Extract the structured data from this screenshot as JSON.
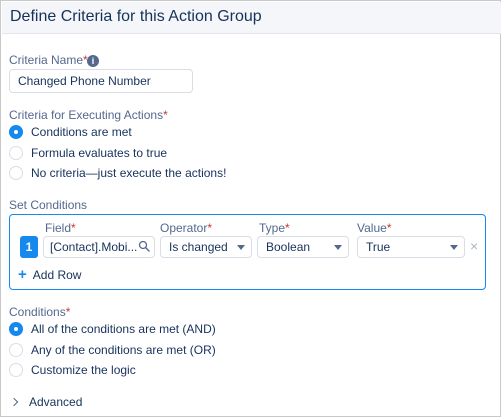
{
  "header": {
    "title": "Define Criteria for this Action Group"
  },
  "criteria_name": {
    "label": "Criteria Name",
    "required_mark": "*",
    "info_glyph": "i",
    "value": "Changed Phone Number"
  },
  "criteria_executing": {
    "label": "Criteria for Executing Actions",
    "required_mark": "*",
    "options": [
      {
        "label": "Conditions are met",
        "checked": true
      },
      {
        "label": "Formula evaluates to true",
        "checked": false
      },
      {
        "label": "No criteria—just execute the actions!",
        "checked": false
      }
    ]
  },
  "set_conditions": {
    "label": "Set Conditions",
    "columns": {
      "field": "Field",
      "operator": "Operator",
      "type": "Type",
      "value": "Value",
      "required_mark": "*"
    },
    "row": {
      "number": "1",
      "field": "[Contact].Mobi...",
      "operator": "Is changed",
      "type": "Boolean",
      "value": "True"
    },
    "remove_glyph": "×",
    "add_row": "Add Row",
    "add_glyph": "+"
  },
  "conditions": {
    "label": "Conditions",
    "required_mark": "*",
    "options": [
      {
        "label": "All of the conditions are met (AND)",
        "checked": true
      },
      {
        "label": "Any of the conditions are met (OR)",
        "checked": false
      },
      {
        "label": "Customize the logic",
        "checked": false
      }
    ]
  },
  "advanced": {
    "label": "Advanced"
  },
  "colors": {
    "accent": "#1589ee",
    "required": "#c23934",
    "text": "#16325c",
    "muted": "#54698d"
  }
}
